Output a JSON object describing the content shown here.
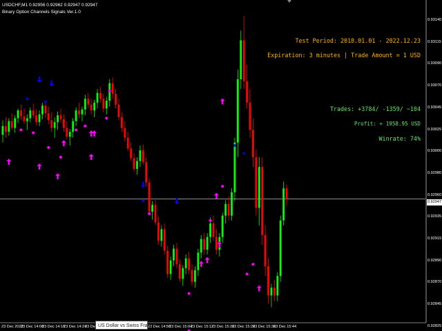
{
  "header": {
    "symbol_line": "USDCHF,M1  0.92956 0.92962 0.92947 0.92947",
    "indicator_name": "Binary Option Channels Signals Ver.1.0"
  },
  "stats": {
    "test_period": "Test Period: 2018.01.01 - 2022.12.23",
    "expiration": "Expiration: 3 minutes | Trade Amount = 1 USD",
    "trades": "Trades: +3784/ -1359/ ~104",
    "profit": "Profit: + 1958.95 USD",
    "winrate": "Winrate: 74%"
  },
  "colors": {
    "background": "#000000",
    "bull": "#00ff00",
    "bear": "#ff0000",
    "signal_arrow": "#ff00ff",
    "signal_dot": "#ff00ff",
    "blue_arrow": "#0000ff",
    "stat_orange": "#ffb400",
    "stat_green": "#64e664",
    "price_line": "#c0c0c0"
  },
  "y_axis": [
    "0.93140",
    "0.93115",
    "0.93090",
    "0.93070",
    "0.93045",
    "0.93025",
    "0.93000",
    "0.92980",
    "0.92960",
    "0.92935",
    "0.92915",
    "0.92890",
    "0.92870",
    "0.92845",
    "0.92825"
  ],
  "current_price": "0.92947",
  "x_axis": [
    "23 Dec 2022",
    "23 Dec 14:08",
    "23 Dec 14:16",
    "23 Dec 14:24",
    "23 Dec 14:5",
    "23 Dec 14:56",
    "23 Dec 15:04",
    "23 Dec 15:12",
    "23 Dec 15:20",
    "23 Dec 15:28",
    "23 Dec 15:36",
    "23 Dec 15:44"
  ],
  "tooltip": "US Dollar vs Swiss Franc",
  "chart_data": {
    "type": "candlestick",
    "ylim": [
      0.9282,
      0.9315
    ],
    "candles": [
      [
        0.93013,
        0.93028,
        0.93005,
        0.93022
      ],
      [
        0.93022,
        0.93031,
        0.9301,
        0.93016
      ],
      [
        0.93016,
        0.9303,
        0.93012,
        0.93027
      ],
      [
        0.93027,
        0.93035,
        0.93018,
        0.9302
      ],
      [
        0.9302,
        0.93033,
        0.93015,
        0.9303
      ],
      [
        0.9303,
        0.9304,
        0.93025,
        0.93038
      ],
      [
        0.93038,
        0.93044,
        0.93028,
        0.93032
      ],
      [
        0.93032,
        0.9304,
        0.93024,
        0.93027
      ],
      [
        0.93027,
        0.93034,
        0.93018,
        0.9303
      ],
      [
        0.9303,
        0.93041,
        0.93026,
        0.93038
      ],
      [
        0.93038,
        0.93045,
        0.9303,
        0.93033
      ],
      [
        0.93033,
        0.93039,
        0.93023,
        0.93026
      ],
      [
        0.93026,
        0.93038,
        0.93022,
        0.93034
      ],
      [
        0.93034,
        0.93046,
        0.93029,
        0.93043
      ],
      [
        0.93043,
        0.93048,
        0.9303,
        0.93035
      ],
      [
        0.93035,
        0.93042,
        0.93024,
        0.93028
      ],
      [
        0.93028,
        0.93036,
        0.93016,
        0.9302
      ],
      [
        0.9302,
        0.93031,
        0.9301,
        0.93026
      ],
      [
        0.93026,
        0.93037,
        0.93018,
        0.93033
      ],
      [
        0.93033,
        0.9304,
        0.93025,
        0.93029
      ],
      [
        0.93029,
        0.93034,
        0.93016,
        0.9302
      ],
      [
        0.9302,
        0.93027,
        0.93008,
        0.93011
      ],
      [
        0.93011,
        0.93019,
        0.93002,
        0.93016
      ],
      [
        0.93016,
        0.9303,
        0.9301,
        0.93027
      ],
      [
        0.93027,
        0.93041,
        0.93022,
        0.93038
      ],
      [
        0.93038,
        0.93046,
        0.9303,
        0.93034
      ],
      [
        0.93034,
        0.93042,
        0.93027,
        0.93039
      ],
      [
        0.93039,
        0.93054,
        0.93033,
        0.9305
      ],
      [
        0.9305,
        0.93056,
        0.9304,
        0.93044
      ],
      [
        0.93044,
        0.9305,
        0.93034,
        0.93038
      ],
      [
        0.93038,
        0.93049,
        0.93031,
        0.93046
      ],
      [
        0.93046,
        0.9306,
        0.9304,
        0.93056
      ],
      [
        0.93056,
        0.93062,
        0.93046,
        0.9305
      ],
      [
        0.9305,
        0.93055,
        0.93036,
        0.9304
      ],
      [
        0.9304,
        0.93052,
        0.93034,
        0.93048
      ],
      [
        0.93048,
        0.9307,
        0.93042,
        0.93066
      ],
      [
        0.93066,
        0.93072,
        0.9305,
        0.93055
      ],
      [
        0.93055,
        0.9306,
        0.9304,
        0.93044
      ],
      [
        0.93044,
        0.9305,
        0.93028,
        0.93031
      ],
      [
        0.93031,
        0.93036,
        0.93016,
        0.9302
      ],
      [
        0.9302,
        0.93027,
        0.93006,
        0.9301
      ],
      [
        0.9301,
        0.93016,
        0.92996,
        0.92999
      ],
      [
        0.92999,
        0.93005,
        0.92986,
        0.92989
      ],
      [
        0.92989,
        0.92994,
        0.92975,
        0.92978
      ],
      [
        0.92978,
        0.9299,
        0.92972,
        0.92986
      ],
      [
        0.92986,
        0.93002,
        0.9298,
        0.92997
      ],
      [
        0.92997,
        0.93003,
        0.92982,
        0.92985
      ],
      [
        0.92985,
        0.9299,
        0.9296,
        0.92964
      ],
      [
        0.92964,
        0.92968,
        0.9293,
        0.92934
      ],
      [
        0.92934,
        0.92945,
        0.92926,
        0.92941
      ],
      [
        0.92941,
        0.92946,
        0.9292,
        0.92923
      ],
      [
        0.92923,
        0.92929,
        0.929,
        0.92904
      ],
      [
        0.92904,
        0.9292,
        0.92898,
        0.92916
      ],
      [
        0.92916,
        0.92922,
        0.9289,
        0.92894
      ],
      [
        0.92894,
        0.92899,
        0.92866,
        0.9287
      ],
      [
        0.9287,
        0.92888,
        0.92864,
        0.92884
      ],
      [
        0.92884,
        0.929,
        0.92878,
        0.92896
      ],
      [
        0.92896,
        0.92902,
        0.92876,
        0.9288
      ],
      [
        0.9288,
        0.92885,
        0.92862,
        0.92865
      ],
      [
        0.92865,
        0.92879,
        0.92858,
        0.92876
      ],
      [
        0.92876,
        0.9289,
        0.9287,
        0.92886
      ],
      [
        0.92886,
        0.92893,
        0.9287,
        0.92874
      ],
      [
        0.92874,
        0.9288,
        0.92858,
        0.92862
      ],
      [
        0.92862,
        0.92878,
        0.92856,
        0.92874
      ],
      [
        0.92874,
        0.92896,
        0.92868,
        0.92892
      ],
      [
        0.92892,
        0.9291,
        0.92886,
        0.92906
      ],
      [
        0.92906,
        0.92912,
        0.9289,
        0.92895
      ],
      [
        0.92895,
        0.92912,
        0.9289,
        0.92908
      ],
      [
        0.92908,
        0.92928,
        0.92902,
        0.92922
      ],
      [
        0.92922,
        0.9293,
        0.92904,
        0.92908
      ],
      [
        0.92908,
        0.92916,
        0.9289,
        0.92895
      ],
      [
        0.92895,
        0.92912,
        0.92888,
        0.92908
      ],
      [
        0.92908,
        0.92933,
        0.92902,
        0.9293
      ],
      [
        0.9293,
        0.92946,
        0.92922,
        0.92942
      ],
      [
        0.92942,
        0.9295,
        0.92925,
        0.9293
      ],
      [
        0.9293,
        0.92958,
        0.92925,
        0.92954
      ],
      [
        0.92954,
        0.9301,
        0.92945,
        0.93005
      ],
      [
        0.93005,
        0.9308,
        0.9299,
        0.9307
      ],
      [
        0.9307,
        0.9312,
        0.9306,
        0.9311
      ],
      [
        0.9311,
        0.93135,
        0.9306,
        0.93068
      ],
      [
        0.93068,
        0.93085,
        0.9304,
        0.93046
      ],
      [
        0.93046,
        0.9306,
        0.9301,
        0.93018
      ],
      [
        0.93018,
        0.9303,
        0.9298,
        0.9299
      ],
      [
        0.9299,
        0.92998,
        0.9293,
        0.92938
      ],
      [
        0.92938,
        0.9299,
        0.9292,
        0.9298
      ],
      [
        0.9298,
        0.9299,
        0.929,
        0.9291
      ],
      [
        0.9291,
        0.9292,
        0.92868,
        0.92878
      ],
      [
        0.92878,
        0.92886,
        0.9284,
        0.92848
      ],
      [
        0.92848,
        0.9286,
        0.92836,
        0.92856
      ],
      [
        0.92856,
        0.92864,
        0.92842,
        0.92848
      ],
      [
        0.92848,
        0.92872,
        0.92842,
        0.92868
      ],
      [
        0.92868,
        0.9293,
        0.92862,
        0.92925
      ],
      [
        0.92925,
        0.92965,
        0.9292,
        0.92958
      ],
      [
        0.92958,
        0.92962,
        0.9294,
        0.92947
      ]
    ],
    "signals": [
      {
        "i": 2,
        "kind": "up_arrow",
        "price": 0.92985
      },
      {
        "i": 6,
        "kind": "dot",
        "price": 0.93018
      },
      {
        "i": 10,
        "kind": "dot",
        "price": 0.93015
      },
      {
        "i": 12,
        "kind": "up_arrow",
        "price": 0.9298
      },
      {
        "i": 15,
        "kind": "dot",
        "price": 0.93
      },
      {
        "i": 18,
        "kind": "up_arrow",
        "price": 0.9297
      },
      {
        "i": 19,
        "kind": "dot",
        "price": 0.9299
      },
      {
        "i": 20,
        "kind": "up_arrow",
        "price": 0.93004
      },
      {
        "i": 24,
        "kind": "dot",
        "price": 0.93018
      },
      {
        "i": 27,
        "kind": "dot",
        "price": 0.93022
      },
      {
        "i": 29,
        "kind": "up_arrow",
        "price": 0.93014
      },
      {
        "i": 30,
        "kind": "up_arrow",
        "price": 0.93014
      },
      {
        "i": 29,
        "kind": "up_arrow",
        "price": 0.9299
      },
      {
        "i": 34,
        "kind": "dot",
        "price": 0.9303
      },
      {
        "i": 35,
        "kind": "dot",
        "price": 0.93058
      },
      {
        "i": 12,
        "kind": "down_arrow_blue",
        "price": 0.9307
      },
      {
        "i": 16,
        "kind": "down_arrow_blue",
        "price": 0.93066
      },
      {
        "i": 46,
        "kind": "down_arrow_blue",
        "price": 0.92962
      },
      {
        "i": 8,
        "kind": "dot_blue",
        "price": 0.9305
      },
      {
        "i": 14,
        "kind": "dot_blue",
        "price": 0.93047
      },
      {
        "i": 46,
        "kind": "dot_blue",
        "price": 0.92945
      },
      {
        "i": 57,
        "kind": "down_arrow_blue",
        "price": 0.92945
      },
      {
        "i": 76,
        "kind": "dot_blue",
        "price": 0.93002
      },
      {
        "i": 79,
        "kind": "dot_blue",
        "price": 0.92994
      },
      {
        "i": 48,
        "kind": "dot",
        "price": 0.92932
      },
      {
        "i": 61,
        "kind": "dot",
        "price": 0.9285
      },
      {
        "i": 61,
        "kind": "up_arrow",
        "price": 0.9281
      },
      {
        "i": 65,
        "kind": "up_arrow",
        "price": 0.9288
      },
      {
        "i": 67,
        "kind": "up_arrow",
        "price": 0.92884
      },
      {
        "i": 68,
        "kind": "dot",
        "price": 0.92925
      },
      {
        "i": 70,
        "kind": "up_arrow",
        "price": 0.9295
      },
      {
        "i": 71,
        "kind": "up_arrow",
        "price": 0.929
      },
      {
        "i": 72,
        "kind": "dot",
        "price": 0.9296
      },
      {
        "i": 72,
        "kind": "up_arrow",
        "price": 0.93047
      },
      {
        "i": 82,
        "kind": "dot",
        "price": 0.9288
      },
      {
        "i": 84,
        "kind": "up_arrow",
        "price": 0.92855
      },
      {
        "i": 80,
        "kind": "dot",
        "price": 0.9287
      }
    ]
  }
}
